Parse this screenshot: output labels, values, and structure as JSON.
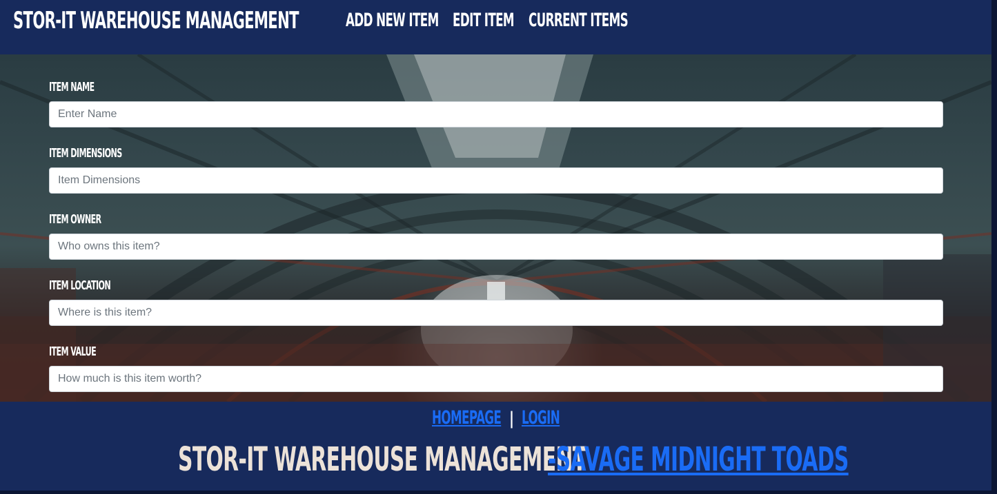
{
  "navbar": {
    "brand": "STOR-IT WAREHOUSE MANAGEMENT",
    "links": {
      "add": "ADD NEW ITEM",
      "edit": "EDIT ITEM",
      "current": "CURRENT ITEMS"
    }
  },
  "form": {
    "fields": [
      {
        "label": "ITEM NAME",
        "placeholder": "Enter Name",
        "value": ""
      },
      {
        "label": "ITEM DIMENSIONS",
        "placeholder": "Item Dimensions",
        "value": ""
      },
      {
        "label": "ITEM OWNER",
        "placeholder": "Who owns this item?",
        "value": ""
      },
      {
        "label": "ITEM LOCATION",
        "placeholder": "Where is this item?",
        "value": ""
      },
      {
        "label": "ITEM VALUE",
        "placeholder": "How much is this item worth?",
        "value": ""
      }
    ]
  },
  "footer": {
    "home_link": "HOMEPAGE",
    "separator": "|",
    "login_link": "LOGIN",
    "title": "STOR-IT WAREHOUSE MANAGEMENT",
    "team_link": "-SAVAGE MIDNIGHT TOADS"
  },
  "colors": {
    "navy": "#172a5c",
    "link_blue": "#1a6cf5",
    "footer_title": "#ece2d8"
  }
}
